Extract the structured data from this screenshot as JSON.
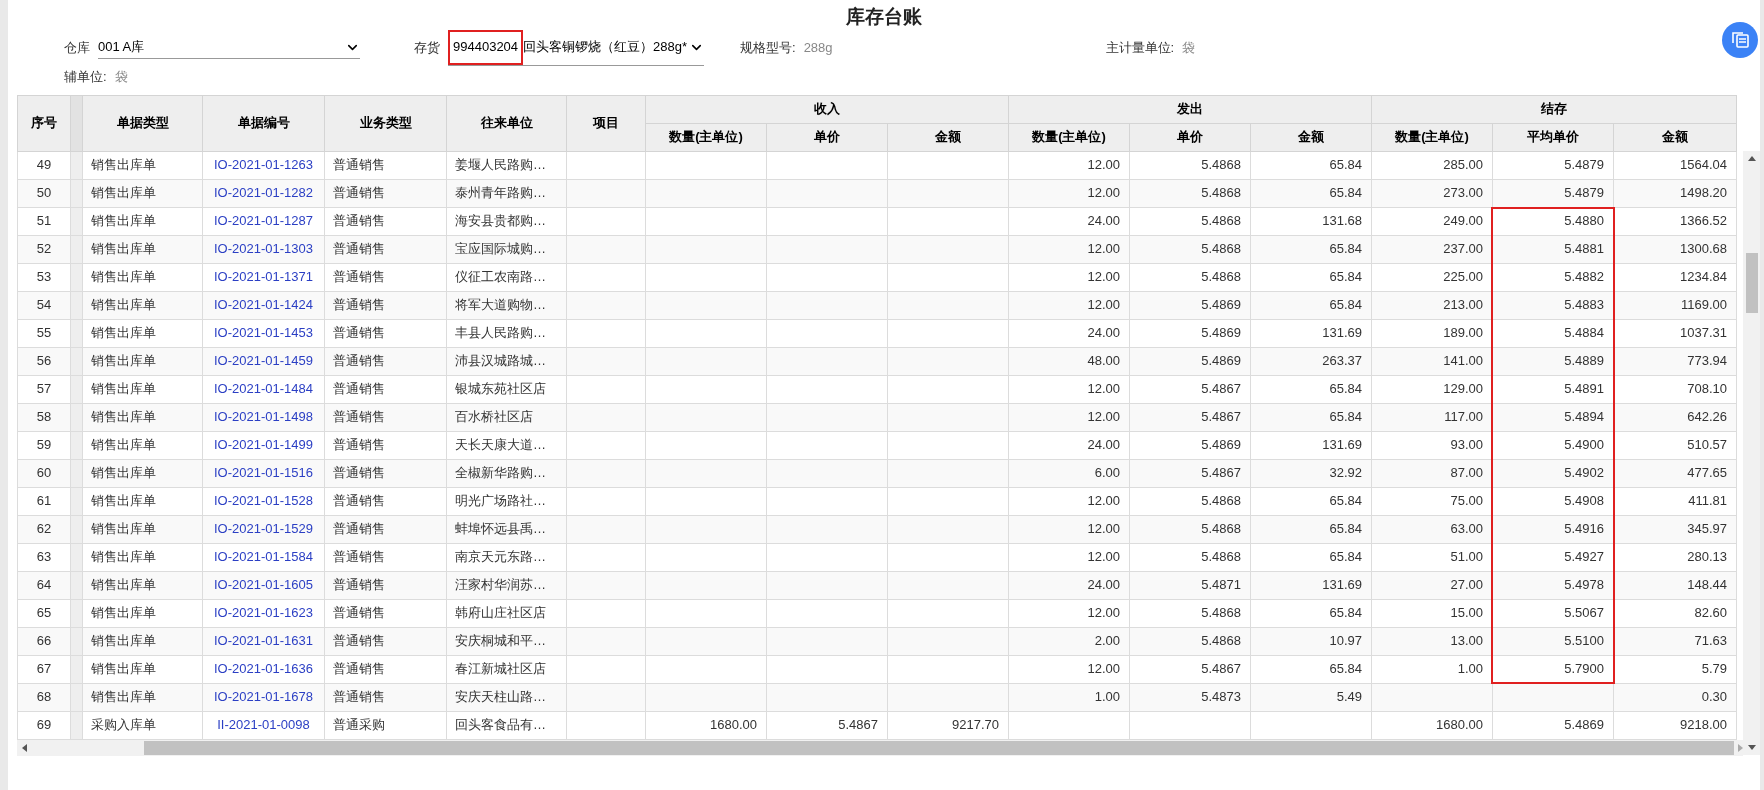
{
  "title": "库存台账",
  "filters": {
    "warehouse": {
      "label": "仓库",
      "value": "001 A库"
    },
    "stock": {
      "label": "存货",
      "code": "994403204",
      "name": "回头客铜锣烧（红豆）288g*",
      "code_marked": true
    },
    "spec": {
      "label": "规格型号:",
      "value": "288g"
    },
    "main_unit": {
      "label": "主计量单位:",
      "value": "袋"
    },
    "aux_unit": {
      "label": "辅单位:",
      "value": "袋"
    }
  },
  "table": {
    "columns": [
      "序号",
      "单据类型",
      "单据编号",
      "业务类型",
      "往来单位",
      "项目"
    ],
    "groups": [
      {
        "label": "收入",
        "columns": [
          "数量(主单位)",
          "单价",
          "金额"
        ]
      },
      {
        "label": "发出",
        "columns": [
          "数量(主单位)",
          "单价",
          "金额"
        ]
      },
      {
        "label": "结存",
        "columns": [
          "数量(主单位)",
          "平均单价",
          "金额"
        ]
      }
    ],
    "rows": [
      {
        "no": "49",
        "doc_type": "销售出库单",
        "doc_no": "IO-2021-01-1263",
        "biz_type": "普通销售",
        "partner": "姜堰人民路购…",
        "out": {
          "qty": "12.00",
          "price": "5.4868",
          "amount": "65.84"
        },
        "bal": {
          "qty": "285.00",
          "price": "5.4879",
          "amount": "1564.04"
        },
        "marked": false
      },
      {
        "no": "50",
        "doc_type": "销售出库单",
        "doc_no": "IO-2021-01-1282",
        "biz_type": "普通销售",
        "partner": "泰州青年路购…",
        "out": {
          "qty": "12.00",
          "price": "5.4868",
          "amount": "65.84"
        },
        "bal": {
          "qty": "273.00",
          "price": "5.4879",
          "amount": "1498.20"
        },
        "marked": false
      },
      {
        "no": "51",
        "doc_type": "销售出库单",
        "doc_no": "IO-2021-01-1287",
        "biz_type": "普通销售",
        "partner": "海安县贵都购…",
        "out": {
          "qty": "24.00",
          "price": "5.4868",
          "amount": "131.68"
        },
        "bal": {
          "qty": "249.00",
          "price": "5.4880",
          "amount": "1366.52"
        },
        "marked": true
      },
      {
        "no": "52",
        "doc_type": "销售出库单",
        "doc_no": "IO-2021-01-1303",
        "biz_type": "普通销售",
        "partner": "宝应国际城购…",
        "out": {
          "qty": "12.00",
          "price": "5.4868",
          "amount": "65.84"
        },
        "bal": {
          "qty": "237.00",
          "price": "5.4881",
          "amount": "1300.68"
        },
        "marked": true
      },
      {
        "no": "53",
        "doc_type": "销售出库单",
        "doc_no": "IO-2021-01-1371",
        "biz_type": "普通销售",
        "partner": "仪征工农南路…",
        "out": {
          "qty": "12.00",
          "price": "5.4868",
          "amount": "65.84"
        },
        "bal": {
          "qty": "225.00",
          "price": "5.4882",
          "amount": "1234.84"
        },
        "marked": true
      },
      {
        "no": "54",
        "doc_type": "销售出库单",
        "doc_no": "IO-2021-01-1424",
        "biz_type": "普通销售",
        "partner": "将军大道购物…",
        "out": {
          "qty": "12.00",
          "price": "5.4869",
          "amount": "65.84"
        },
        "bal": {
          "qty": "213.00",
          "price": "5.4883",
          "amount": "1169.00"
        },
        "marked": true
      },
      {
        "no": "55",
        "doc_type": "销售出库单",
        "doc_no": "IO-2021-01-1453",
        "biz_type": "普通销售",
        "partner": "丰县人民路购…",
        "out": {
          "qty": "24.00",
          "price": "5.4869",
          "amount": "131.69"
        },
        "bal": {
          "qty": "189.00",
          "price": "5.4884",
          "amount": "1037.31"
        },
        "marked": true
      },
      {
        "no": "56",
        "doc_type": "销售出库单",
        "doc_no": "IO-2021-01-1459",
        "biz_type": "普通销售",
        "partner": "沛县汉城路城…",
        "out": {
          "qty": "48.00",
          "price": "5.4869",
          "amount": "263.37"
        },
        "bal": {
          "qty": "141.00",
          "price": "5.4889",
          "amount": "773.94"
        },
        "marked": true
      },
      {
        "no": "57",
        "doc_type": "销售出库单",
        "doc_no": "IO-2021-01-1484",
        "biz_type": "普通销售",
        "partner": "银城东苑社区店",
        "out": {
          "qty": "12.00",
          "price": "5.4867",
          "amount": "65.84"
        },
        "bal": {
          "qty": "129.00",
          "price": "5.4891",
          "amount": "708.10"
        },
        "marked": true
      },
      {
        "no": "58",
        "doc_type": "销售出库单",
        "doc_no": "IO-2021-01-1498",
        "biz_type": "普通销售",
        "partner": "百水桥社区店",
        "out": {
          "qty": "12.00",
          "price": "5.4867",
          "amount": "65.84"
        },
        "bal": {
          "qty": "117.00",
          "price": "5.4894",
          "amount": "642.26"
        },
        "marked": true
      },
      {
        "no": "59",
        "doc_type": "销售出库单",
        "doc_no": "IO-2021-01-1499",
        "biz_type": "普通销售",
        "partner": "天长天康大道…",
        "out": {
          "qty": "24.00",
          "price": "5.4869",
          "amount": "131.69"
        },
        "bal": {
          "qty": "93.00",
          "price": "5.4900",
          "amount": "510.57"
        },
        "marked": true
      },
      {
        "no": "60",
        "doc_type": "销售出库单",
        "doc_no": "IO-2021-01-1516",
        "biz_type": "普通销售",
        "partner": "全椒新华路购…",
        "out": {
          "qty": "6.00",
          "price": "5.4867",
          "amount": "32.92"
        },
        "bal": {
          "qty": "87.00",
          "price": "5.4902",
          "amount": "477.65"
        },
        "marked": true
      },
      {
        "no": "61",
        "doc_type": "销售出库单",
        "doc_no": "IO-2021-01-1528",
        "biz_type": "普通销售",
        "partner": "明光广场路社…",
        "out": {
          "qty": "12.00",
          "price": "5.4868",
          "amount": "65.84"
        },
        "bal": {
          "qty": "75.00",
          "price": "5.4908",
          "amount": "411.81"
        },
        "marked": true
      },
      {
        "no": "62",
        "doc_type": "销售出库单",
        "doc_no": "IO-2021-01-1529",
        "biz_type": "普通销售",
        "partner": "蚌埠怀远县禹…",
        "out": {
          "qty": "12.00",
          "price": "5.4868",
          "amount": "65.84"
        },
        "bal": {
          "qty": "63.00",
          "price": "5.4916",
          "amount": "345.97"
        },
        "marked": true
      },
      {
        "no": "63",
        "doc_type": "销售出库单",
        "doc_no": "IO-2021-01-1584",
        "biz_type": "普通销售",
        "partner": "南京天元东路…",
        "out": {
          "qty": "12.00",
          "price": "5.4868",
          "amount": "65.84"
        },
        "bal": {
          "qty": "51.00",
          "price": "5.4927",
          "amount": "280.13"
        },
        "marked": true
      },
      {
        "no": "64",
        "doc_type": "销售出库单",
        "doc_no": "IO-2021-01-1605",
        "biz_type": "普通销售",
        "partner": "汪家村华润苏…",
        "out": {
          "qty": "24.00",
          "price": "5.4871",
          "amount": "131.69"
        },
        "bal": {
          "qty": "27.00",
          "price": "5.4978",
          "amount": "148.44"
        },
        "marked": true
      },
      {
        "no": "65",
        "doc_type": "销售出库单",
        "doc_no": "IO-2021-01-1623",
        "biz_type": "普通销售",
        "partner": "韩府山庄社区店",
        "out": {
          "qty": "12.00",
          "price": "5.4868",
          "amount": "65.84"
        },
        "bal": {
          "qty": "15.00",
          "price": "5.5067",
          "amount": "82.60"
        },
        "marked": true
      },
      {
        "no": "66",
        "doc_type": "销售出库单",
        "doc_no": "IO-2021-01-1631",
        "biz_type": "普通销售",
        "partner": "安庆桐城和平…",
        "out": {
          "qty": "2.00",
          "price": "5.4868",
          "amount": "10.97"
        },
        "bal": {
          "qty": "13.00",
          "price": "5.5100",
          "amount": "71.63"
        },
        "marked": true
      },
      {
        "no": "67",
        "doc_type": "销售出库单",
        "doc_no": "IO-2021-01-1636",
        "biz_type": "普通销售",
        "partner": "春江新城社区店",
        "out": {
          "qty": "12.00",
          "price": "5.4867",
          "amount": "65.84"
        },
        "bal": {
          "qty": "1.00",
          "price": "5.7900",
          "amount": "5.79"
        },
        "marked": true
      },
      {
        "no": "68",
        "doc_type": "销售出库单",
        "doc_no": "IO-2021-01-1678",
        "biz_type": "普通销售",
        "partner": "安庆天柱山路…",
        "out": {
          "qty": "1.00",
          "price": "5.4873",
          "amount": "5.49"
        },
        "bal": {
          "amount": "0.30"
        },
        "marked": false
      },
      {
        "no": "69",
        "doc_type": "采购入库单",
        "doc_no": "II-2021-01-0098",
        "biz_type": "普通采购",
        "partner": "回头客食品有…",
        "in": {
          "qty": "1680.00",
          "price": "5.4867",
          "amount": "9217.70"
        },
        "bal": {
          "qty": "1680.00",
          "price": "5.4869",
          "amount": "9218.00"
        },
        "marked": false
      }
    ]
  }
}
